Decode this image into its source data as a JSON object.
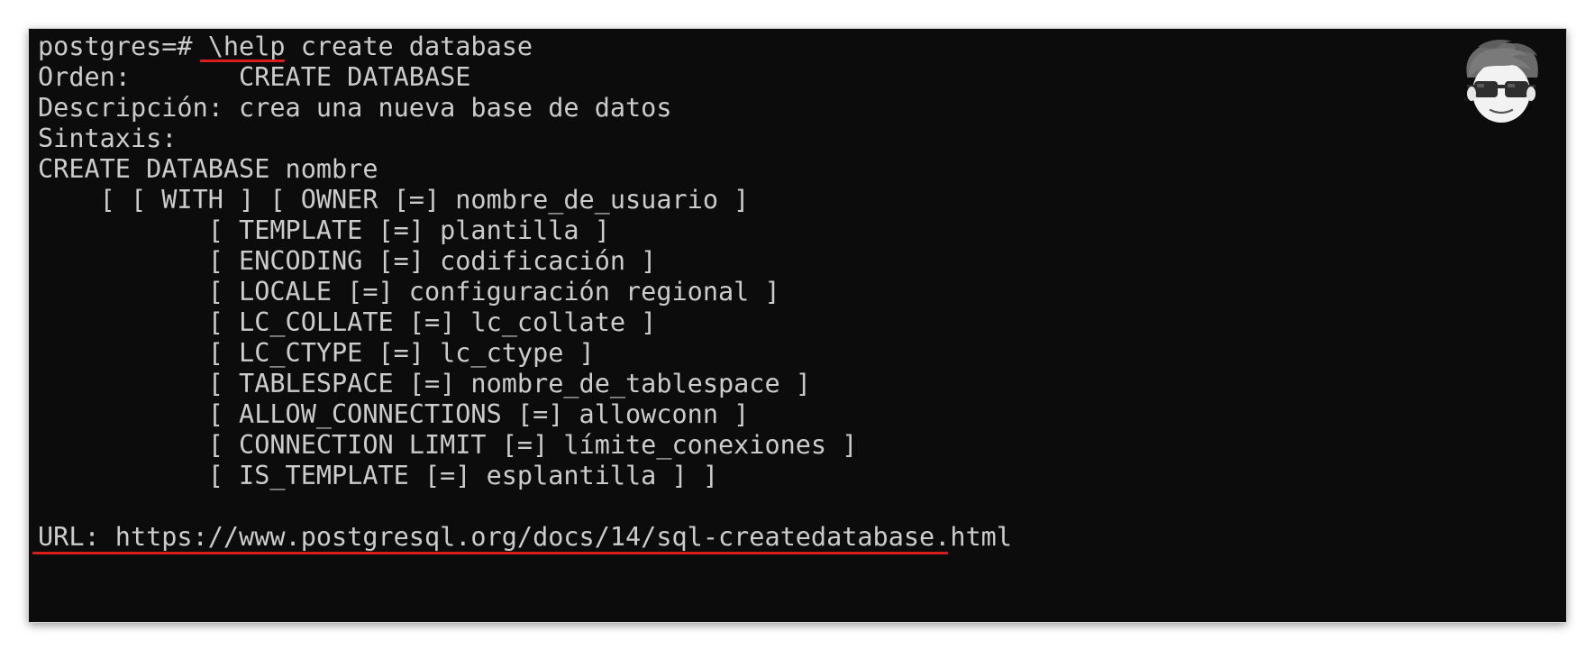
{
  "terminal": {
    "lines": [
      "postgres=# \\help create database",
      "Orden:       CREATE DATABASE",
      "Descripción: crea una nueva base de datos",
      "Sintaxis:",
      "CREATE DATABASE nombre",
      "    [ [ WITH ] [ OWNER [=] nombre_de_usuario ]",
      "           [ TEMPLATE [=] plantilla ]",
      "           [ ENCODING [=] codificación ]",
      "           [ LOCALE [=] configuración regional ]",
      "           [ LC_COLLATE [=] lc_collate ]",
      "           [ LC_CTYPE [=] lc_ctype ]",
      "           [ TABLESPACE [=] nombre_de_tablespace ]",
      "           [ ALLOW_CONNECTIONS [=] allowconn ]",
      "           [ CONNECTION LIMIT [=] límite_conexiones ]",
      "           [ IS_TEMPLATE [=] esplantilla ] ]",
      "",
      "URL: https://www.postgresql.org/docs/14/sql-createdatabase.html"
    ]
  },
  "colors": {
    "background": "#0c0c0c",
    "text": "#cccccc",
    "highlight_underline": "#d91d1d"
  },
  "icons": {
    "avatar": "cartoon-avatar-with-sunglasses-icon"
  }
}
